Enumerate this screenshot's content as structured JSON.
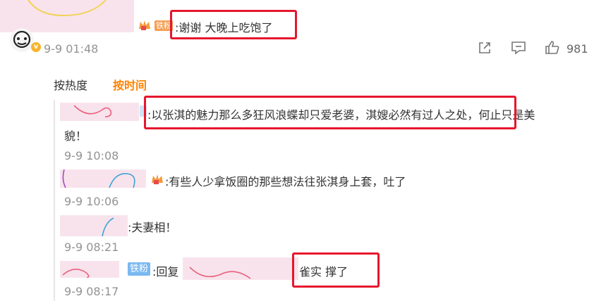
{
  "main_comment": {
    "badge": "铁粉",
    "text": ":谢谢 大晚上吃饱了",
    "time": "9-9 01:48",
    "likes": "981"
  },
  "tabs": [
    {
      "label": "按热度",
      "active": false
    },
    {
      "label": "按时间",
      "active": true
    }
  ],
  "replies": [
    {
      "text": ":以张淇的魅力那么多狂风浪蝶却只爱老婆，淇嫂必然有过人之处，何止只是美",
      "text_cont": "貌！",
      "time": "9-9 10:08"
    },
    {
      "text": ":有些人少拿饭圈的那些想法往张淇身上套，吐了",
      "time": "9-9 10:06"
    },
    {
      "text": ":夫妻相！",
      "time": "9-9 08:21"
    },
    {
      "badge": "铁粉",
      "text_prefix": ":回复",
      "text": "雀实 撑了",
      "time": "9-9 08:17"
    }
  ],
  "colors": {
    "accent_orange": "#ff8200",
    "highlight_red": "#e6162d",
    "time_gray": "#939393"
  },
  "icons": [
    "avatar-icon",
    "vip-v-icon",
    "crown-icon",
    "share-icon",
    "comment-icon",
    "like-icon"
  ]
}
